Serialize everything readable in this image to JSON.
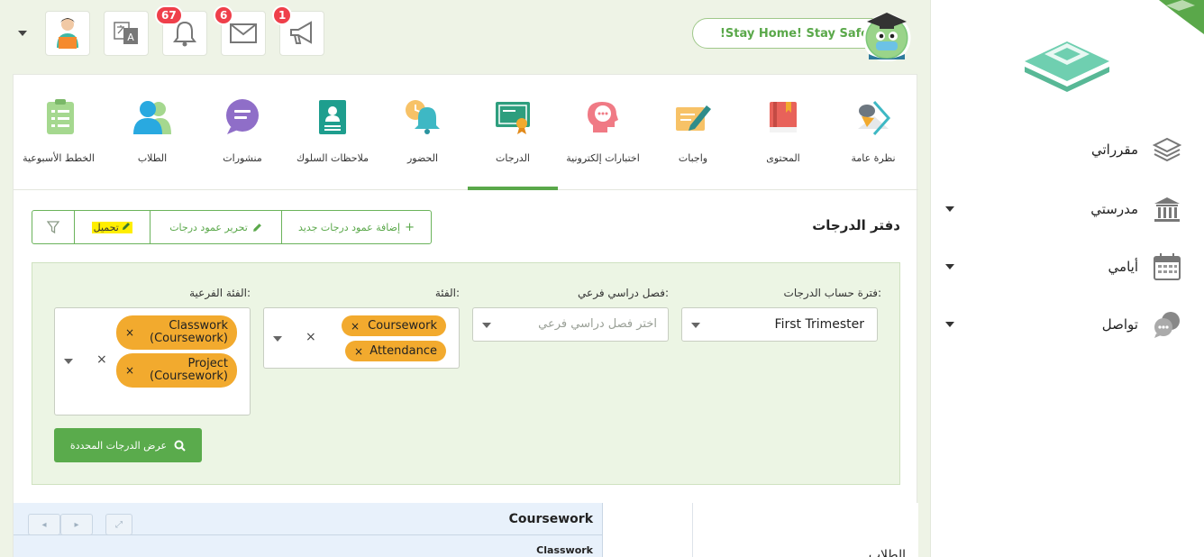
{
  "sidebar": {
    "items": [
      {
        "label": "مقرراتي",
        "icon": "layers-icon",
        "has_dropdown": false
      },
      {
        "label": "مدرستي",
        "icon": "school-building-icon",
        "has_dropdown": true
      },
      {
        "label": "أيامي",
        "icon": "calendar-icon",
        "has_dropdown": true
      },
      {
        "label": "تواصل",
        "icon": "chat-bubbles-icon",
        "has_dropdown": true
      }
    ]
  },
  "topbar": {
    "slogan": "!Stay Home! Stay Safe",
    "badges": {
      "notifications": "67",
      "messages": "6",
      "announcements": "1"
    }
  },
  "tabs": [
    {
      "label": "نظرة عامة",
      "icon": "overview-icon"
    },
    {
      "label": "المحتوى",
      "icon": "book-icon"
    },
    {
      "label": "واجبات",
      "icon": "assignment-pen-icon"
    },
    {
      "label": "اختبارات إلكترونية",
      "icon": "quiz-head-icon"
    },
    {
      "label": "الدرجات",
      "icon": "grades-certificate-icon",
      "active": true
    },
    {
      "label": "الحضور",
      "icon": "attendance-bell-icon"
    },
    {
      "label": "ملاحظات السلوك",
      "icon": "behavior-notes-icon"
    },
    {
      "label": "منشورات",
      "icon": "posts-chat-icon"
    },
    {
      "label": "الطلاب",
      "icon": "students-icon"
    },
    {
      "label": "الخطط الأسبوعية",
      "icon": "weekly-plan-icon"
    }
  ],
  "gradebook": {
    "title": "دفتر الدرجات",
    "toolbar": {
      "add_column": "إضافة عمود درجات جديد",
      "edit_column": "تحرير عمود درجات",
      "load": "تحميل"
    },
    "filters": {
      "period_label": "فترة حساب الدرجات:",
      "period_value": "First Trimester",
      "subterm_label": "فصل دراسي فرعي:",
      "subterm_placeholder": "اختر فصل دراسي فرعي",
      "category_label": "الفئة:",
      "categories": [
        "Coursework",
        "Attendance"
      ],
      "subcategory_label": "الفئة الفرعية:",
      "subcategories": [
        {
          "line1": "Classwork",
          "line2": "(Coursework)"
        },
        {
          "line1": "Project",
          "line2": "(Coursework)"
        }
      ],
      "show_button": "عرض الدرجات المحددة"
    },
    "grid": {
      "header": "Coursework",
      "subheader": "Classwork",
      "students_label": "الطلاب"
    }
  },
  "colors": {
    "accent": "#5aa84a",
    "chip": "#f2aa2e",
    "badge": "#ef3f4a",
    "highlight": "#ffee00"
  }
}
